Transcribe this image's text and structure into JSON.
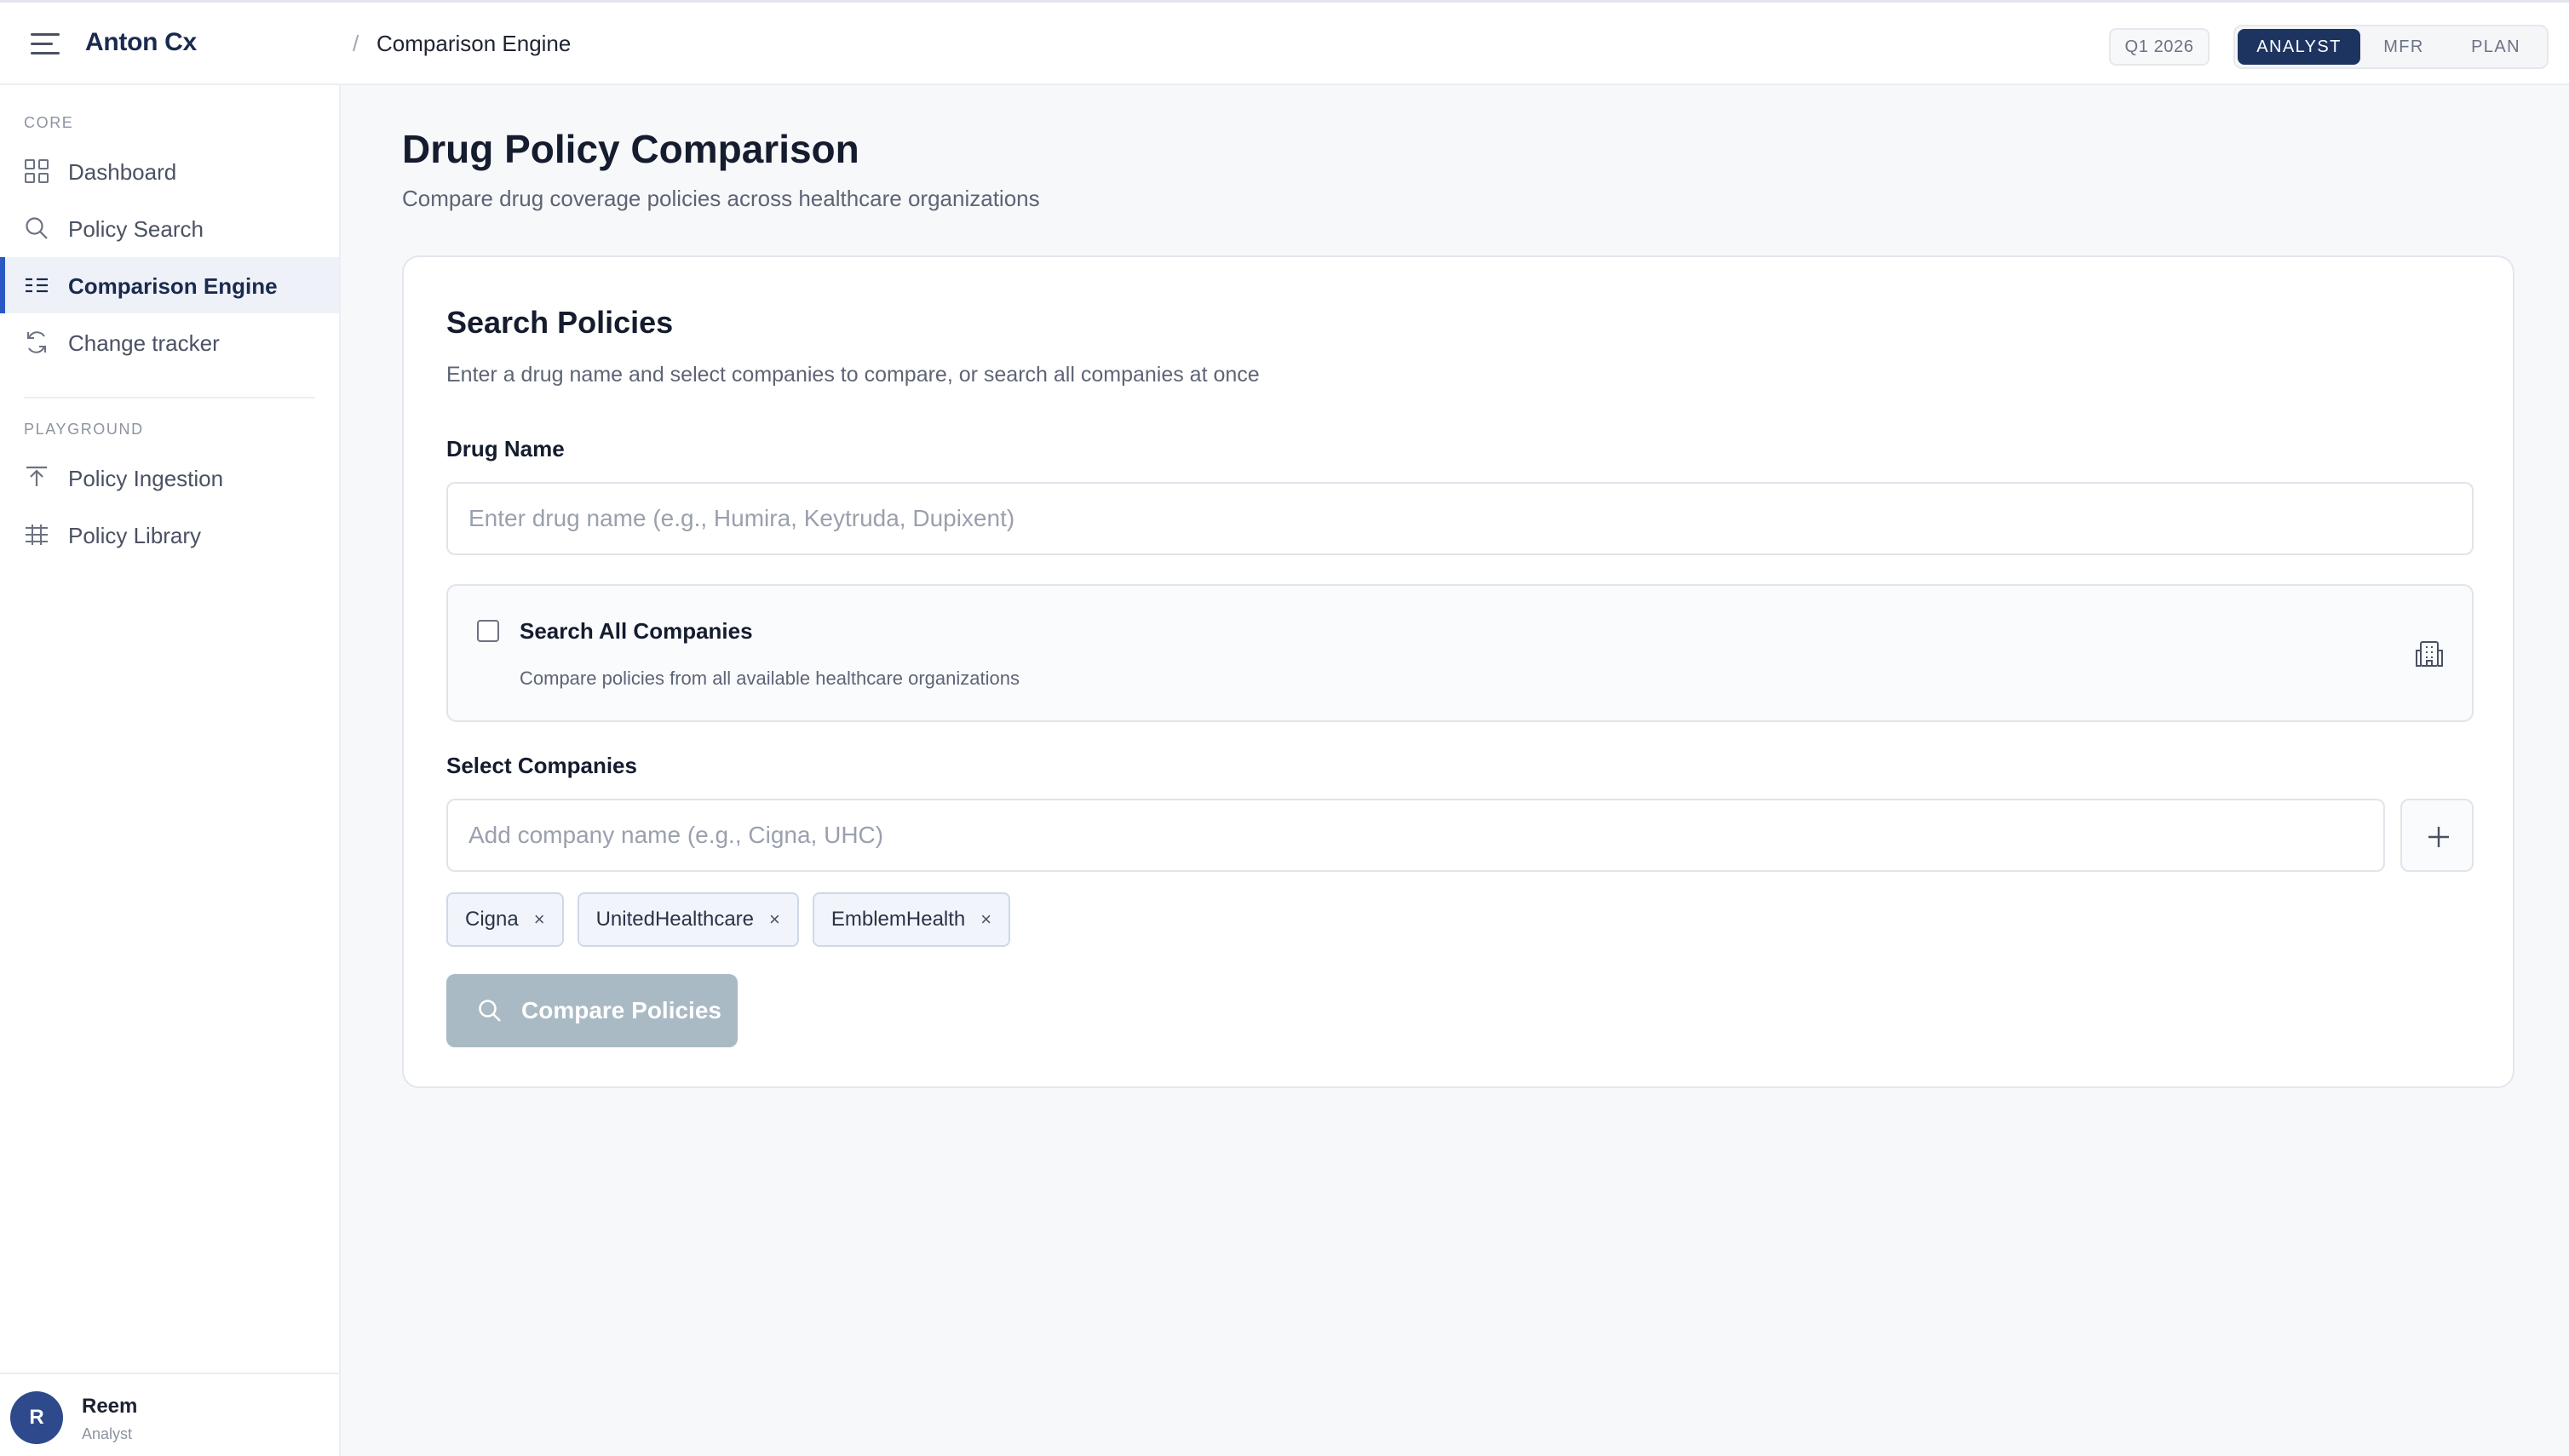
{
  "header": {
    "brand": "Anton Cx",
    "breadcrumb_separator": "/",
    "breadcrumb": "Comparison Engine",
    "period": "Q1 2026",
    "roles": [
      "ANALYST",
      "MFR",
      "PLAN"
    ],
    "active_role": "ANALYST"
  },
  "sidebar": {
    "core_label": "CORE",
    "core_items": [
      {
        "label": "Dashboard",
        "icon": "grid-icon"
      },
      {
        "label": "Policy Search",
        "icon": "search-icon"
      },
      {
        "label": "Comparison Engine",
        "icon": "list-icon",
        "active": true
      },
      {
        "label": "Change tracker",
        "icon": "refresh-icon"
      }
    ],
    "playground_label": "PLAYGROUND",
    "playground_items": [
      {
        "label": "Policy Ingestion",
        "icon": "upload-icon"
      },
      {
        "label": "Policy Library",
        "icon": "table-icon"
      }
    ],
    "user": {
      "initial": "R",
      "name": "Reem",
      "role": "Analyst"
    }
  },
  "main": {
    "title": "Drug Policy Comparison",
    "subtitle": "Compare drug coverage policies across healthcare organizations",
    "card": {
      "title": "Search Policies",
      "description": "Enter a drug name and select companies to compare, or search all companies at once",
      "drug_label": "Drug Name",
      "drug_placeholder": "Enter drug name (e.g., Humira, Keytruda, Dupixent)",
      "drug_value": "",
      "search_all_title": "Search All Companies",
      "search_all_desc": "Compare policies from all available healthcare organizations",
      "search_all_checked": false,
      "companies_label": "Select Companies",
      "company_placeholder": "Add company name (e.g., Cigna, UHC)",
      "company_value": "",
      "add_symbol": "+",
      "remove_symbol": "×",
      "selected_companies": [
        "Cigna",
        "UnitedHealthcare",
        "EmblemHealth"
      ],
      "compare_button": "Compare Policies"
    }
  },
  "colors": {
    "brand": "#1a2a4f",
    "active_role_bg": "#1d3461",
    "nav_active_accent": "#2b59c3",
    "compare_button_disabled": "#a9bac4"
  }
}
